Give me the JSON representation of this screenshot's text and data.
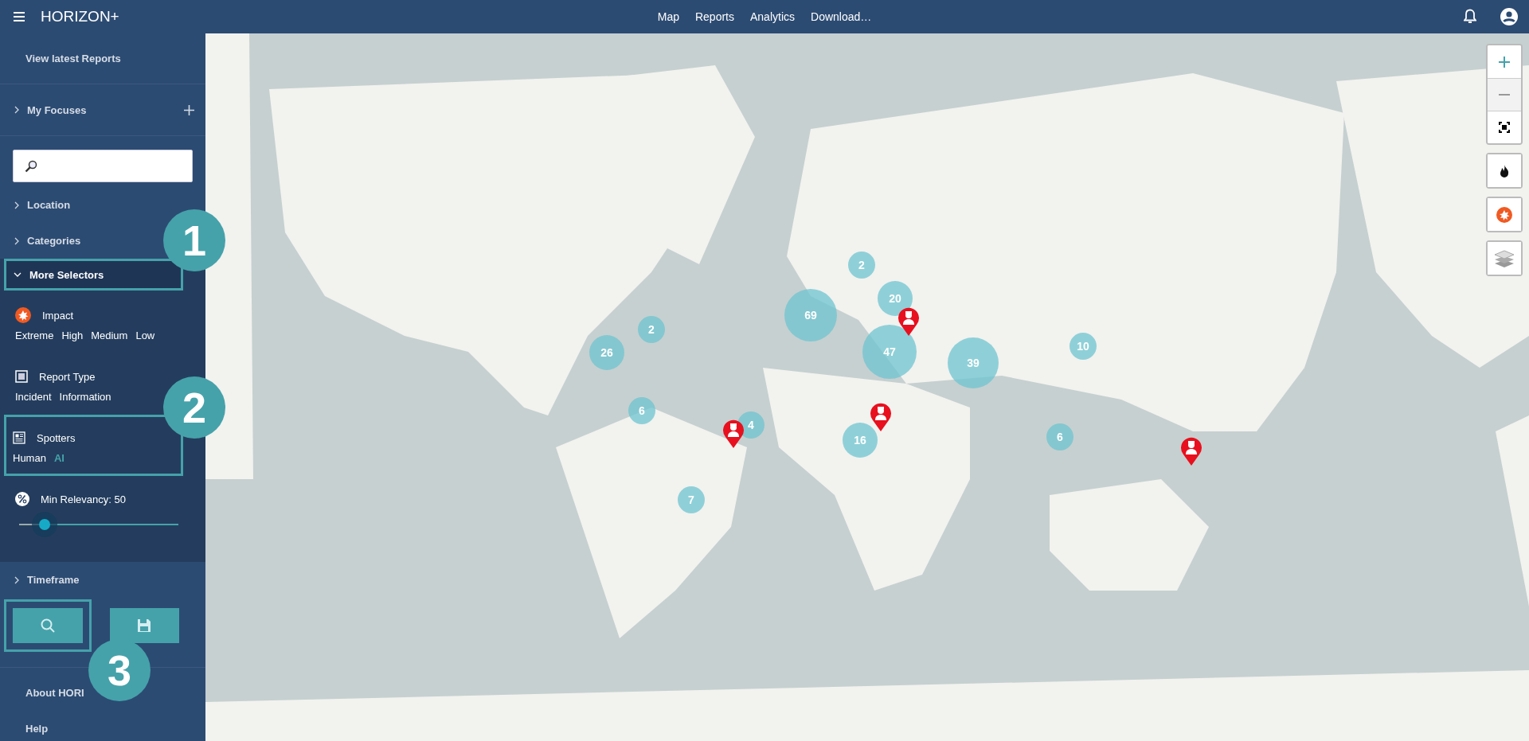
{
  "app": {
    "title": "HORIZON+"
  },
  "nav": [
    "Map",
    "Reports",
    "Analytics",
    "Download…"
  ],
  "sidebar": {
    "view_latest": "View latest Reports",
    "my_focuses": {
      "label": "My Focuses",
      "expanded": false
    },
    "sections": [
      {
        "label": "Location",
        "expanded": false,
        "highlighted": false
      },
      {
        "label": "Categories",
        "expanded": false,
        "highlighted": false
      },
      {
        "label": "More Selectors",
        "expanded": true,
        "highlighted": true
      }
    ],
    "selectors": [
      {
        "kind": "options",
        "title": "Impact",
        "highlighted": false,
        "options": [
          {
            "label": "Extreme",
            "selected": false
          },
          {
            "label": "High",
            "selected": false
          },
          {
            "label": "Medium",
            "selected": false
          },
          {
            "label": "Low",
            "selected": false
          }
        ]
      },
      {
        "kind": "options",
        "title": "Report Type",
        "highlighted": false,
        "options": [
          {
            "label": "Incident",
            "selected": false
          },
          {
            "label": "Information",
            "selected": false
          }
        ]
      },
      {
        "kind": "options",
        "title": "Spotters",
        "highlighted": true,
        "options": [
          {
            "label": "Human",
            "selected": false
          },
          {
            "label": "AI",
            "selected": true
          }
        ]
      },
      {
        "kind": "slider",
        "title": "Min Relevancy: 50",
        "level": 0.16
      }
    ],
    "timeframe": {
      "label": "Timeframe",
      "expanded": false
    },
    "actions": [
      {
        "kind": "search",
        "highlighted": true
      },
      {
        "kind": "save",
        "highlighted": false
      }
    ],
    "links": [
      "About HORI",
      "Help"
    ]
  },
  "map": {
    "clusters": [
      {
        "count": "2"
      },
      {
        "count": "20"
      },
      {
        "count": "69"
      },
      {
        "count": "2"
      },
      {
        "count": "26"
      },
      {
        "count": "47"
      },
      {
        "count": "39"
      },
      {
        "count": "10"
      },
      {
        "count": "6"
      },
      {
        "count": "4"
      },
      {
        "count": "16"
      },
      {
        "count": "6"
      },
      {
        "count": "7"
      }
    ],
    "pins": [
      {
        "kind": "spotter"
      },
      {
        "kind": "spotter"
      },
      {
        "kind": "spotter"
      },
      {
        "kind": "spotter"
      }
    ],
    "controls": [
      {
        "kind": "zoom-in",
        "disabled": false
      },
      {
        "kind": "zoom-out",
        "disabled": true
      },
      {
        "kind": "fullscreen"
      },
      {
        "kind": "heat"
      },
      {
        "kind": "impact"
      },
      {
        "kind": "layers"
      }
    ]
  },
  "callouts": [
    "1",
    "2",
    "3"
  ]
}
